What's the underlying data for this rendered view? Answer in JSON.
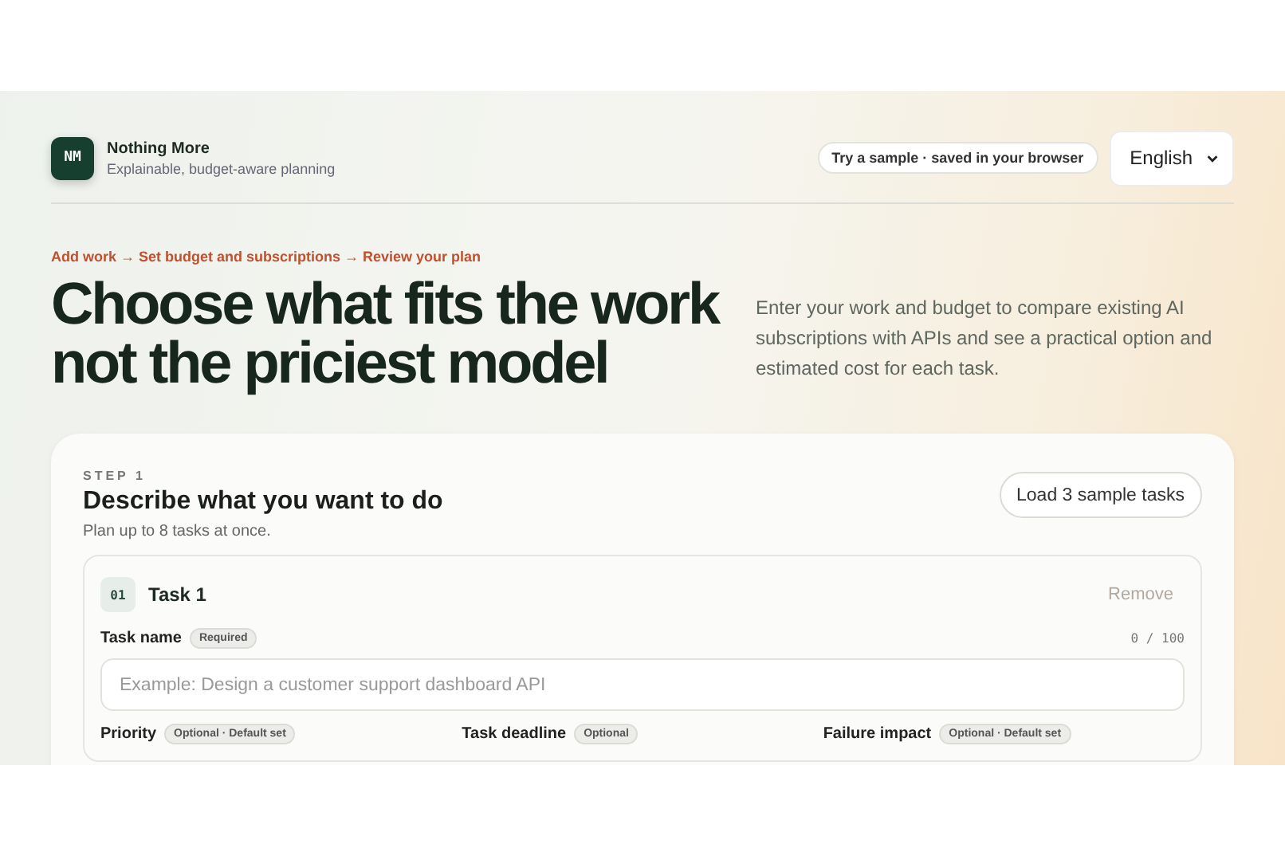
{
  "header": {
    "logo": "NM",
    "brand": "Nothing More",
    "tagline": "Explainable, budget-aware planning",
    "sample_badge": "Try a sample · saved in your browser",
    "language": "English"
  },
  "hero": {
    "breadcrumb": "Add work → Set budget and subscriptions → Review your plan",
    "heading_lines": [
      "Choose what fits the work",
      "not the priciest model"
    ],
    "description": "Enter your work and budget to compare existing AI subscriptions with APIs and see a practical option and estimated cost for each task."
  },
  "step": {
    "label": "STEP 1",
    "title": "Describe what you want to do",
    "subtitle": "Plan up to 8 tasks at once.",
    "load_button": "Load 3 sample tasks"
  },
  "tasks": [
    {
      "number": "01",
      "title": "Task 1",
      "remove": {
        "label": "Remove",
        "disabled": true
      },
      "name_field": {
        "label": "Task name",
        "tag": "Required",
        "counter": "0 / 100",
        "placeholder": "Example: Design a customer support dashboard API"
      },
      "options": [
        {
          "label": "Priority",
          "tag": "Optional · Default set"
        },
        {
          "label": "Task deadline",
          "tag": "Optional"
        },
        {
          "label": "Failure impact",
          "tag": "Optional · Default set"
        }
      ]
    }
  ]
}
